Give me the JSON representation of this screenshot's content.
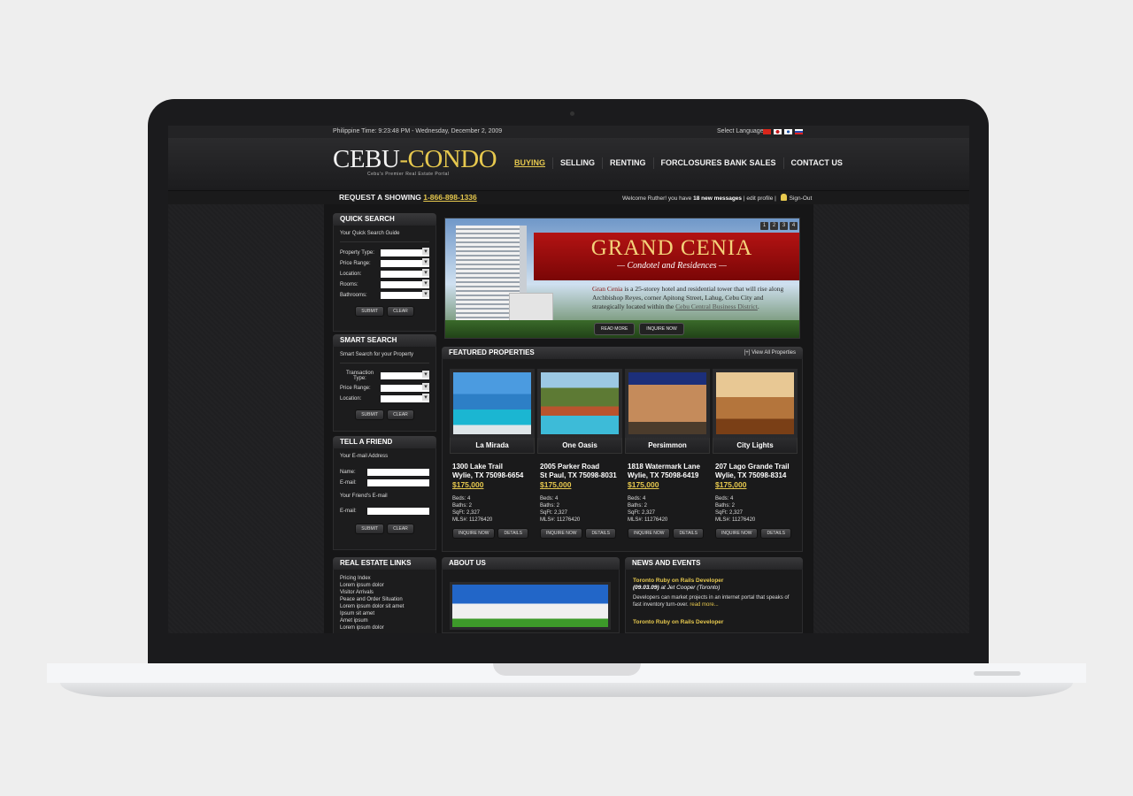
{
  "topbar": {
    "time": "Philippine Time: 9:23:48 PM - Wednesday, December 2, 2009",
    "lang_label": "Select Language:"
  },
  "header": {
    "logo_cebu": "CEBU",
    "logo_dash": "-",
    "logo_condo": "CONDO",
    "tagline": "Cebu's Premier Real Estate Portal"
  },
  "nav": [
    "BUYING",
    "SELLING",
    "RENTING",
    "FORCLOSURES BANK SALES",
    "CONTACT US"
  ],
  "subbar": {
    "request": "REQUEST A SHOWING",
    "phone": "1-866-898-1336",
    "welcome_prefix": "Welcome Ruther! you have",
    "messages": "18 new messages",
    "edit": "| edit profile |",
    "signout": "Sign-Out"
  },
  "quick_search": {
    "title": "QUICK SEARCH",
    "guide": "Your Quick Search Guide",
    "fields": [
      "Property Type:",
      "Price Range:",
      "Location:",
      "Rooms:",
      "Bathrooms:"
    ],
    "submit": "SUBMIT",
    "clear": "CLEAR"
  },
  "smart_search": {
    "title": "SMART SEARCH",
    "guide": "Smart Search for your Property",
    "fields": [
      "Transaction Type:",
      "Price Range:",
      "Location:"
    ],
    "submit": "SUBMIT",
    "clear": "CLEAR"
  },
  "tell_friend": {
    "title": "TELL A FRIEND",
    "your_email": "Your E-mail Address",
    "name": "Name:",
    "email": "E-mail:",
    "friend_email": "Your Friend's E-mail",
    "email2": "E-mail:",
    "submit": "SUBMIT",
    "clear": "CLEAR"
  },
  "links": {
    "title": "REAL ESTATE LINKS",
    "items": [
      "Pricing Index",
      "Lorem ipsum dolor",
      "Visitor Arrivals",
      "Peace and Order Situation",
      "Lorem ipsum dolor sit amet",
      "Ipsum sit amet",
      "Amet ipsum",
      "Lorem ipsum dolor"
    ]
  },
  "banner": {
    "pages": [
      "1",
      "2",
      "3",
      "4"
    ],
    "title": "GRAND CENIA",
    "subtitle": "— Condotel and Residences —",
    "desc_name": "Gran Cenia",
    "desc_text": " is a 25-storey hotel and residential tower that will rise along Archbishop Reyes, corner Apitong Street, Lahug, Cebu City and strategically located within the ",
    "desc_link": "Cebu Central Business District",
    "desc_end": ".",
    "read_more": "READ MORE",
    "inquire": "INQUIRE NOW"
  },
  "featured": {
    "title": "FEATURED PROPERTIES",
    "view_all": "[+] View All Properties",
    "inquire": "INQUIRE NOW",
    "details": "DETAILS",
    "items": [
      {
        "name": "La Mirada",
        "street": "1300 Lake Trail",
        "city": "Wylie, TX 75098-6654",
        "price": "$175,000",
        "beds": "Beds: 4",
        "baths": "Baths: 2",
        "sqft": "SqFt: 2,327",
        "mls": "MLS#: 11276420"
      },
      {
        "name": "One Oasis",
        "street": "2005 Parker Road",
        "city": "St Paul, TX 75098-8031",
        "price": "$175,000",
        "beds": "Beds: 4",
        "baths": "Baths: 2",
        "sqft": "SqFt: 2,327",
        "mls": "MLS#: 11276420"
      },
      {
        "name": "Persimmon",
        "street": "1818 Watermark Lane",
        "city": "Wylie, TX 75098-6419",
        "price": "$175,000",
        "beds": "Beds: 4",
        "baths": "Baths: 2",
        "sqft": "SqFt: 2,327",
        "mls": "MLS#: 11276420"
      },
      {
        "name": "City Lights",
        "street": "207 Lago Grande Trail",
        "city": "Wylie, TX 75098-8314",
        "price": "$175,000",
        "beds": "Beds: 4",
        "baths": "Baths: 2",
        "sqft": "SqFt: 2,327",
        "mls": "MLS#: 11276420"
      }
    ]
  },
  "about": {
    "title": "ABOUT US"
  },
  "news": {
    "title": "NEWS AND EVENTS",
    "item1_title": "Toronto Ruby on Rails Developer",
    "item1_date": "(09.03.09)",
    "item1_at": " at Jet Cooper (Toronto)",
    "item1_text": "Developers can market projects in an internet portal that speaks of fast inventory turn-over. ",
    "item1_more": "read more...",
    "item2_title": "Toronto Ruby on Rails Developer"
  },
  "colors": {
    "accent": "#e6c84e",
    "banner_red": "#b31313"
  }
}
